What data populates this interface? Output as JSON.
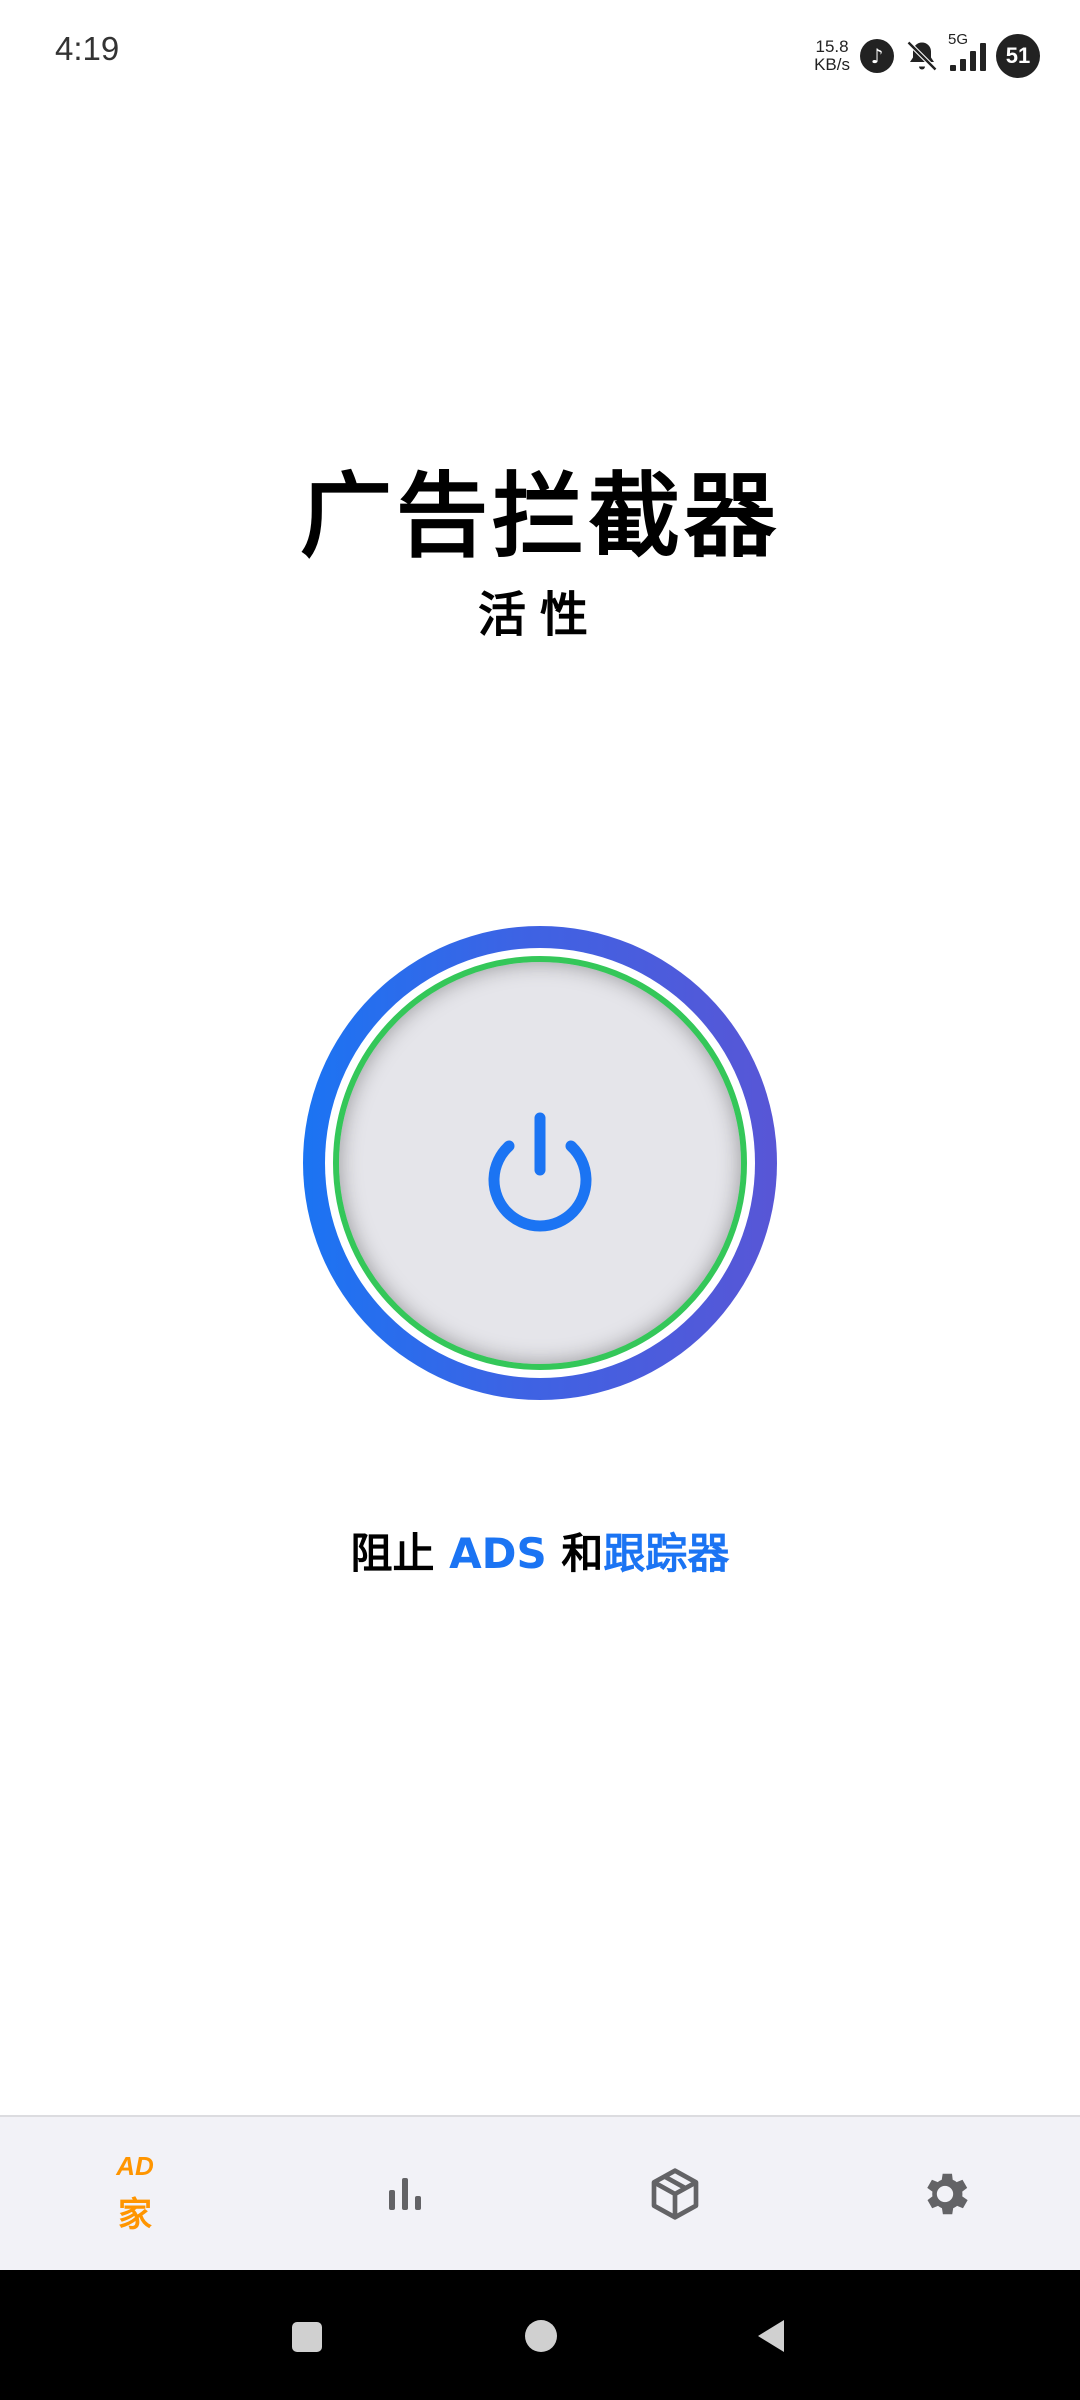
{
  "status_bar": {
    "time": "4:19",
    "net_speed_value": "15.8",
    "net_speed_unit": "KB/s",
    "network_type": "5G",
    "battery": "51"
  },
  "header": {
    "title": "广告拦截器",
    "status": "活性"
  },
  "power_button": {
    "icon": "power-icon",
    "ring_color": "#34c759",
    "icon_color": "#1b74f3"
  },
  "tagline": {
    "part1": "阻止 ",
    "part2": "ADS",
    "part3": " 和",
    "part4": "跟踪器"
  },
  "bottom_nav": {
    "items": [
      {
        "icon": "ad-icon",
        "icon_text": "AD",
        "label": "家",
        "active": true
      },
      {
        "icon": "bar-chart-icon"
      },
      {
        "icon": "box-icon"
      },
      {
        "icon": "gear-icon"
      }
    ],
    "active_color": "#ff9500",
    "inactive_color": "#636366"
  },
  "system_nav": {
    "buttons": [
      "recents-icon",
      "home-icon",
      "back-icon"
    ]
  }
}
